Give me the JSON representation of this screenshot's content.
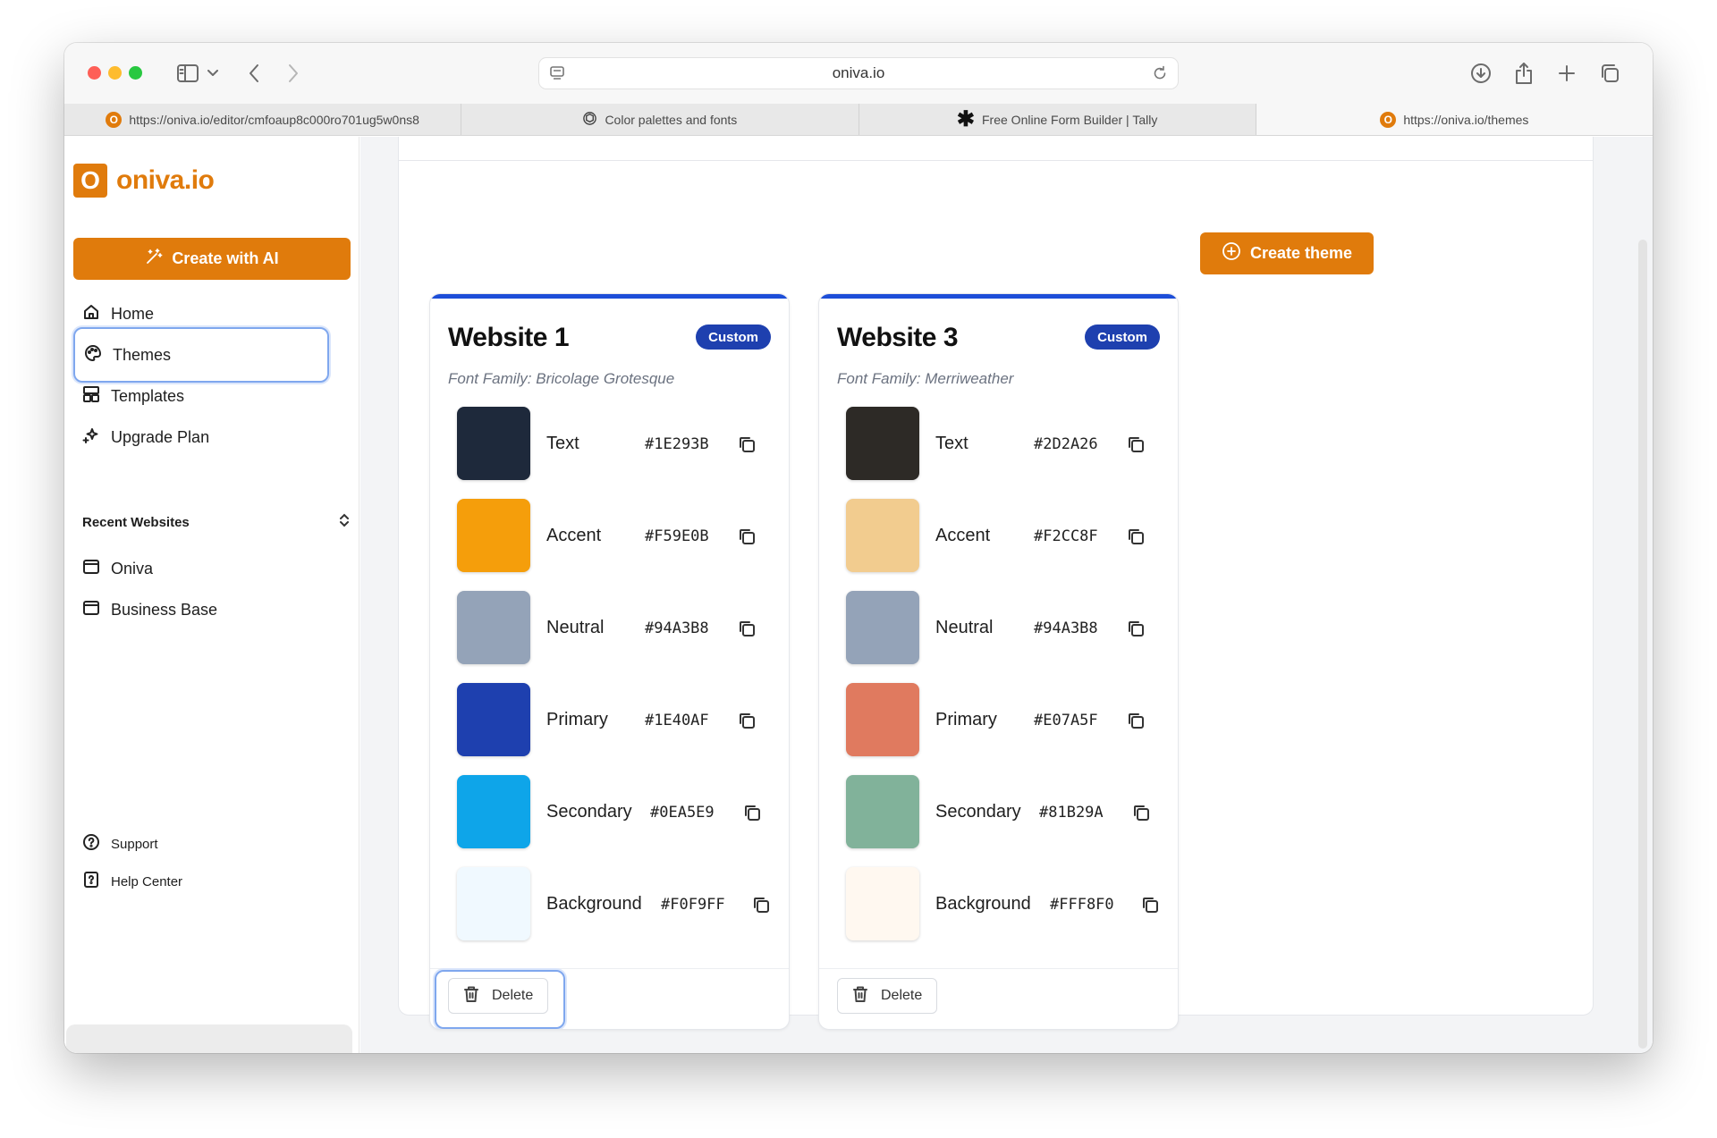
{
  "browser": {
    "url": "oniva.io",
    "tabs": [
      {
        "label": "https://oniva.io/editor/cmfoaup8c000ro701ug5w0ns8",
        "icon": "oniva-favicon",
        "active": false
      },
      {
        "label": "Color palettes and fonts",
        "icon": "openai-icon",
        "active": false
      },
      {
        "label": "Free Online Form Builder | Tally",
        "icon": "tally-asterisk-icon",
        "active": false
      },
      {
        "label": "https://oniva.io/themes",
        "icon": "oniva-favicon",
        "active": true
      }
    ]
  },
  "sidebar": {
    "logo_mark": "O",
    "logo_text": "oniva.io",
    "create_ai_label": "Create with AI",
    "nav": [
      {
        "label": "Home",
        "icon": "home-icon"
      },
      {
        "label": "Themes",
        "icon": "palette-icon",
        "selected": true
      },
      {
        "label": "Templates",
        "icon": "templates-icon"
      },
      {
        "label": "Upgrade Plan",
        "icon": "sparkles-icon"
      }
    ],
    "recent_heading": "Recent Websites",
    "recent": [
      {
        "label": "Oniva",
        "icon": "browser-window-icon"
      },
      {
        "label": "Business Base",
        "icon": "browser-window-icon"
      }
    ],
    "bottom": [
      {
        "label": "Support",
        "icon": "help-circle-icon"
      },
      {
        "label": "Help Center",
        "icon": "help-file-icon"
      }
    ]
  },
  "main": {
    "create_theme_label": "Create theme",
    "themes": [
      {
        "title": "Website 1",
        "badge": "Custom",
        "font": "Font Family: Bricolage Grotesque",
        "delete_label": "Delete",
        "colors": [
          {
            "label": "Text",
            "hex": "#1E293B"
          },
          {
            "label": "Accent",
            "hex": "#F59E0B"
          },
          {
            "label": "Neutral",
            "hex": "#94A3B8"
          },
          {
            "label": "Primary",
            "hex": "#1E40AF"
          },
          {
            "label": "Secondary",
            "hex": "#0EA5E9"
          },
          {
            "label": "Background",
            "hex": "#F0F9FF"
          }
        ]
      },
      {
        "title": "Website 3",
        "badge": "Custom",
        "font": "Font Family: Merriweather",
        "delete_label": "Delete",
        "colors": [
          {
            "label": "Text",
            "hex": "#2D2A26"
          },
          {
            "label": "Accent",
            "hex": "#F2CC8F"
          },
          {
            "label": "Neutral",
            "hex": "#94A3B8"
          },
          {
            "label": "Primary",
            "hex": "#E07A5F"
          },
          {
            "label": "Secondary",
            "hex": "#81B29A"
          },
          {
            "label": "Background",
            "hex": "#FFF8F0"
          }
        ]
      }
    ]
  },
  "colors": {
    "brand": "#E07B0C",
    "badge": "#1E40AF",
    "focus_ring": "#7FA7EE"
  }
}
